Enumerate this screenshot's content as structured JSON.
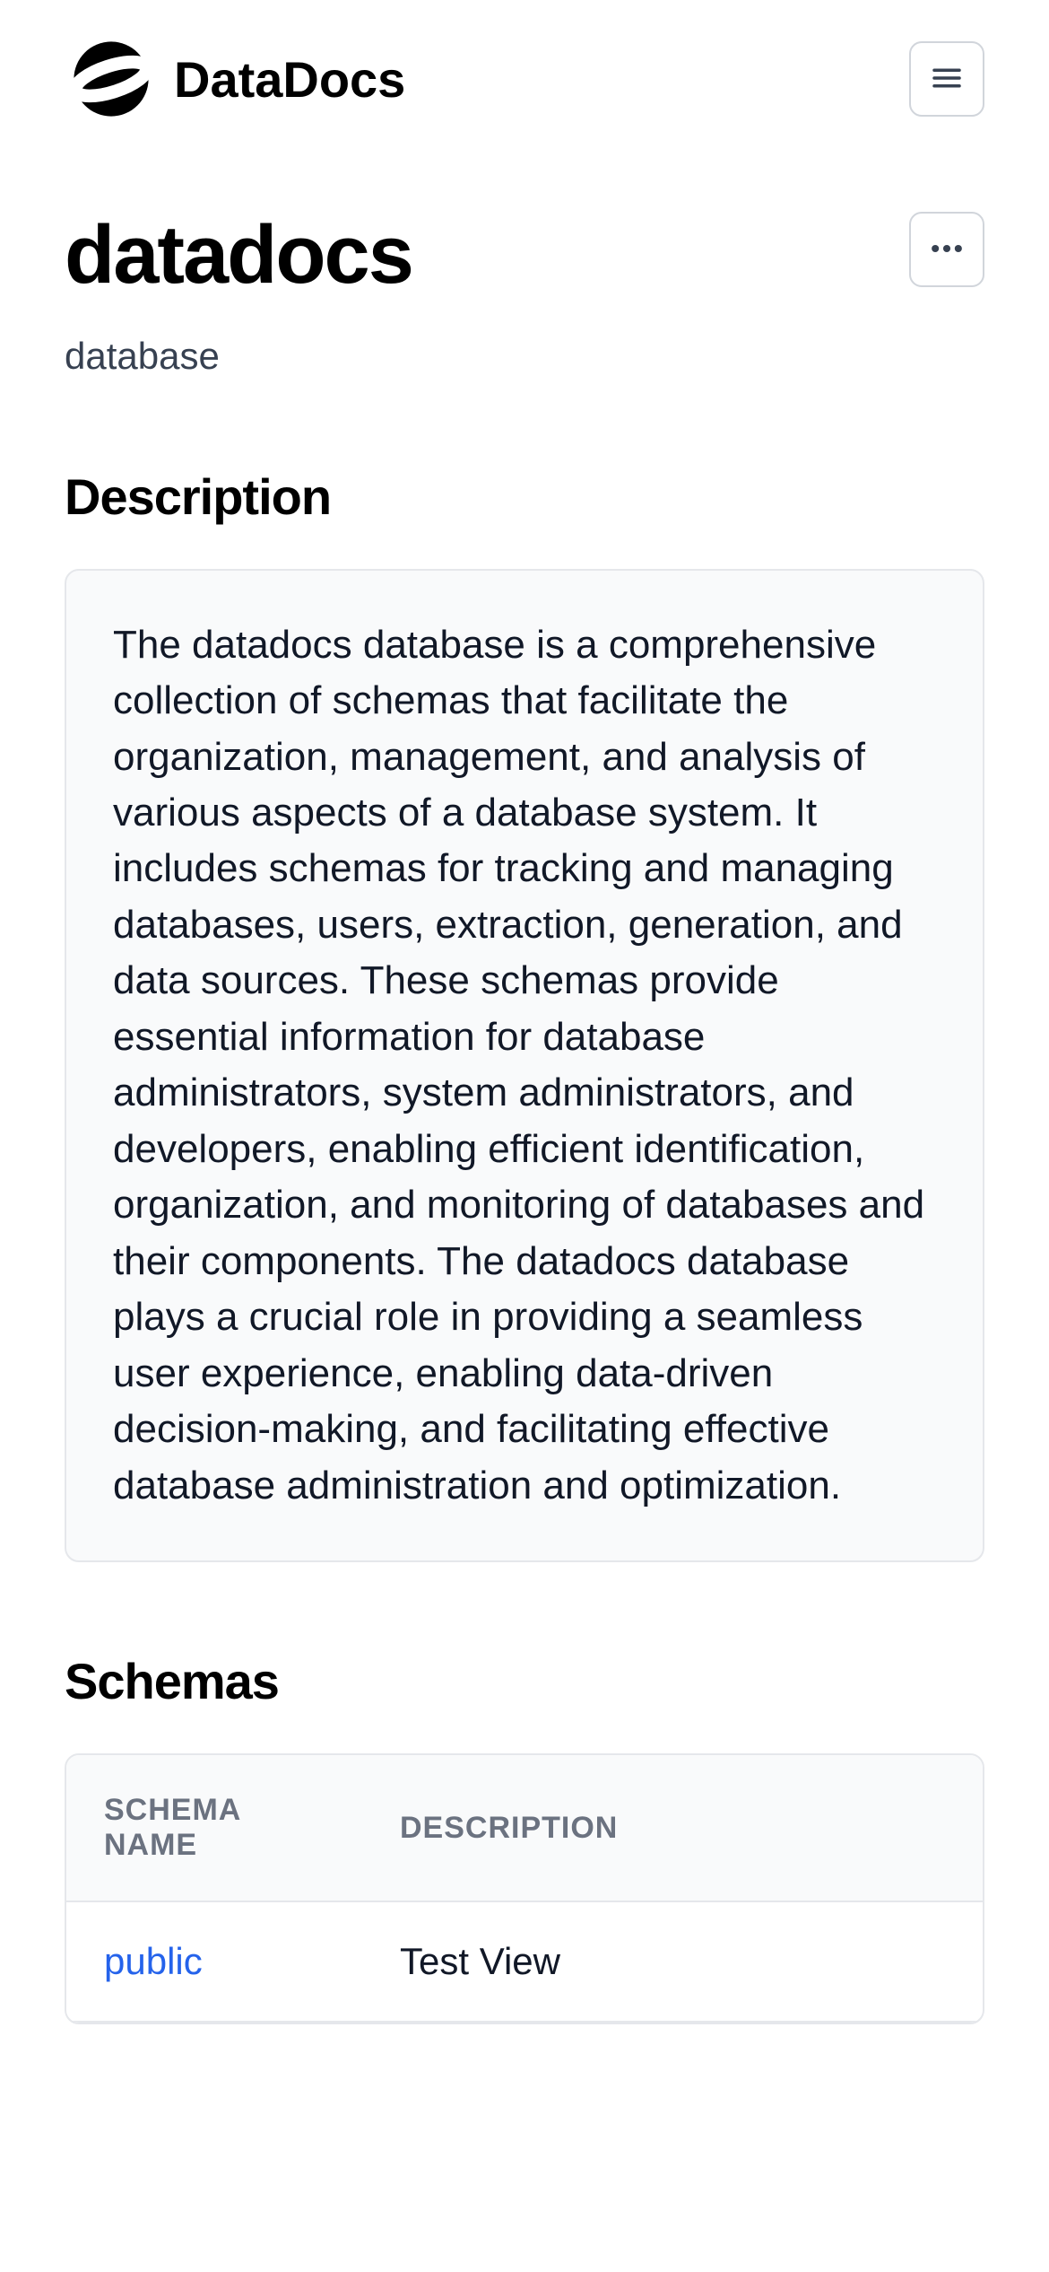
{
  "brand": {
    "name": "DataDocs"
  },
  "page": {
    "title": "datadocs",
    "subtitle": "database"
  },
  "description": {
    "heading": "Description",
    "body": "The datadocs database is a comprehensive collection of schemas that facilitate the organization, management, and analysis of various aspects of a database system. It includes schemas for tracking and managing databases, users, extraction, generation, and data sources. These schemas provide essential information for database administrators, system administrators, and developers, enabling efficient identification, organization, and monitoring of databases and their components. The datadocs database plays a crucial role in providing a seamless user experience, enabling data-driven decision-making, and facilitating effective database administration and optimization."
  },
  "schemas": {
    "heading": "Schemas",
    "columns": {
      "name": "SCHEMA NAME",
      "description": "DESCRIPTION"
    },
    "rows": [
      {
        "name": "public",
        "description": "Test View"
      }
    ]
  }
}
